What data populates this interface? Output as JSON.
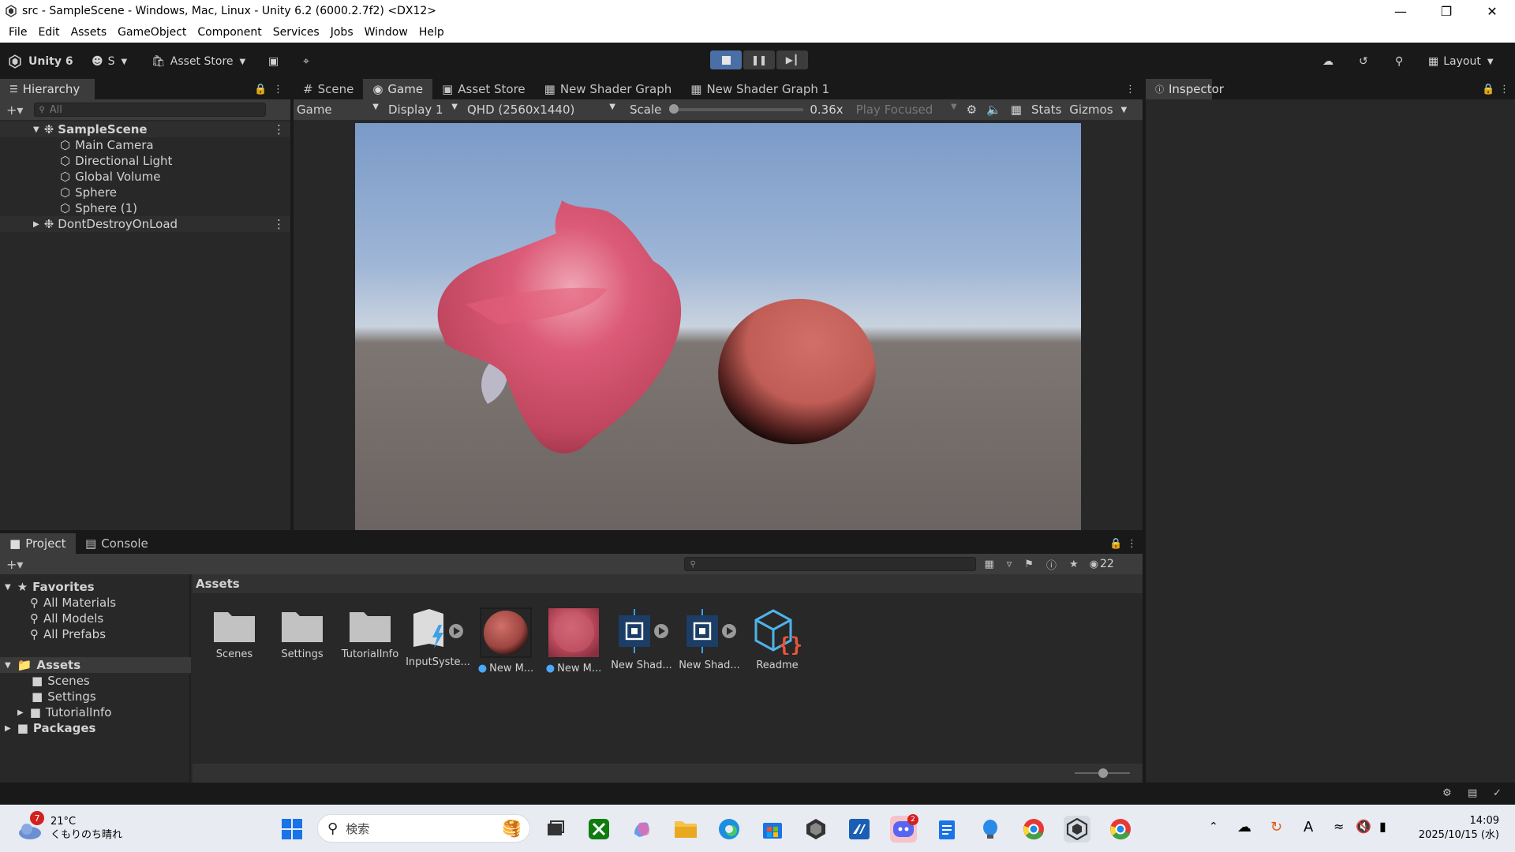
{
  "window": {
    "title": "src - SampleScene - Windows, Mac, Linux - Unity 6.2 (6000.2.7f2) <DX12>"
  },
  "menu": [
    "File",
    "Edit",
    "Assets",
    "GameObject",
    "Component",
    "Services",
    "Jobs",
    "Window",
    "Help"
  ],
  "toolbar": {
    "unity_label": "Unity 6",
    "account_label": "S",
    "asset_store_label": "Asset Store",
    "layout_label": "Layout"
  },
  "hierarchy": {
    "tab_label": "Hierarchy",
    "search_placeholder": "All",
    "scene": "SampleScene",
    "children": [
      "Main Camera",
      "Directional Light",
      "Global Volume",
      "Sphere",
      "Sphere (1)"
    ],
    "dont_destroy": "DontDestroyOnLoad"
  },
  "center_tabs": [
    "Scene",
    "Game",
    "Asset Store",
    "New Shader Graph",
    "New Shader Graph 1"
  ],
  "game_bar": {
    "mode": "Game",
    "display": "Display 1",
    "resolution": "QHD (2560x1440)",
    "scale_label": "Scale",
    "scale_value": "0.36x",
    "play_focused": "Play Focused",
    "stats": "Stats",
    "gizmos": "Gizmos",
    "scale_fraction": 0.0
  },
  "inspector": {
    "tab_label": "Inspector"
  },
  "project": {
    "tabs": [
      "Project",
      "Console"
    ],
    "hidden_count": "22",
    "breadcrumb": "Assets",
    "favorites_label": "Favorites",
    "favorites": [
      "All Materials",
      "All Models",
      "All Prefabs"
    ],
    "assets_label": "Assets",
    "assets_children": [
      "Scenes",
      "Settings",
      "TutorialInfo"
    ],
    "packages_label": "Packages",
    "items": [
      "Scenes",
      "Settings",
      "TutorialInfo",
      "InputSyste...",
      "New M...",
      "New M...",
      "New Shad...",
      "New Shad...",
      "Readme"
    ]
  },
  "taskbar": {
    "weather_temp": "21°C",
    "weather_desc": "くもりのち晴れ",
    "weather_badge": "7",
    "search_placeholder": "検索",
    "time": "14:09",
    "date": "2025/10/15 (水)",
    "discord_badge": "2"
  },
  "colors": {
    "accent": "#4a6fa5",
    "sphere": "#c9605a",
    "blob": "#d9506a"
  }
}
